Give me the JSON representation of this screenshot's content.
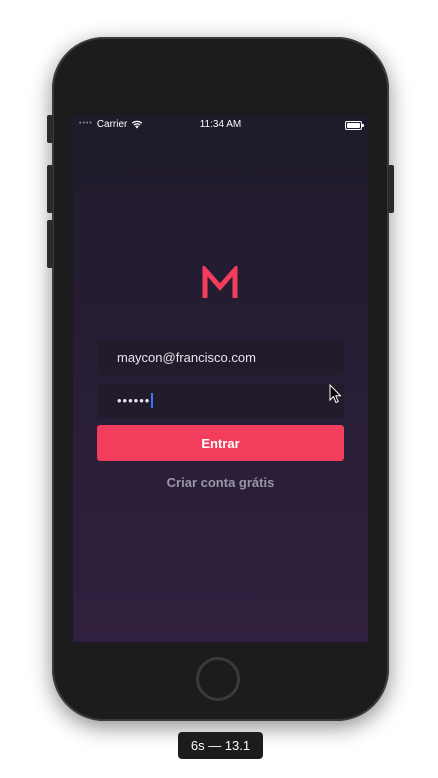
{
  "status_bar": {
    "carrier": "Carrier",
    "time": "11:34 AM",
    "signal_icon": "signal-dots",
    "wifi_icon": "wifi-icon",
    "battery_icon": "battery-icon"
  },
  "login": {
    "logo_letter": "M",
    "email_value": "maycon@francisco.com",
    "password_value": "••••••",
    "submit_label": "Entrar",
    "create_account_label": "Criar conta grátis"
  },
  "device": {
    "label": "6s — 13.1"
  },
  "colors": {
    "accent": "#f23d5c",
    "background_top": "#1f1b2a",
    "background_bottom": "#30203f",
    "field_bg": "#211b2b",
    "link": "#9a95a6"
  }
}
